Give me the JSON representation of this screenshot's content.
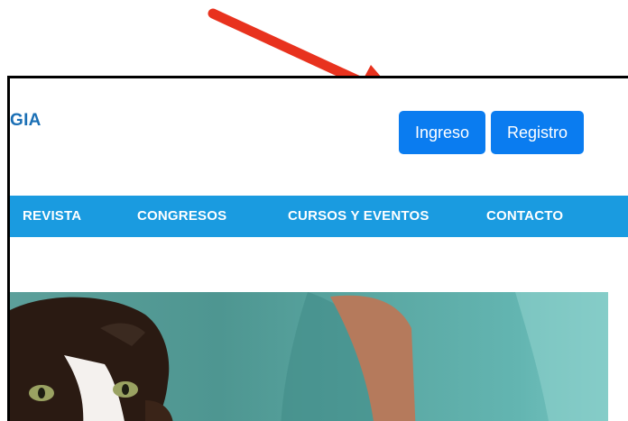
{
  "header": {
    "logo_fragment": "GIA",
    "login_button": "Ingreso",
    "register_button": "Registro"
  },
  "nav": {
    "items": [
      "REVISTA",
      "CONGRESOS",
      "CURSOS Y EVENTOS",
      "CONTACTO"
    ]
  },
  "colors": {
    "primary_button": "#0a7cf0",
    "navbar": "#1a9be0",
    "logo_text": "#1a6fb5",
    "annotation_arrow": "#e8321e"
  },
  "hero": {
    "image": "cat-with-veterinarian-photo"
  },
  "annotation": {
    "icon": "red-arrow-icon"
  }
}
